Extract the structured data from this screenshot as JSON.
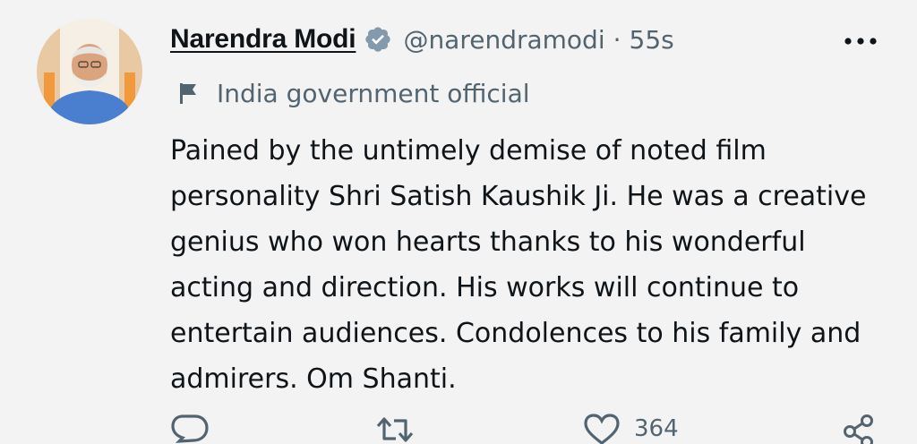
{
  "author": {
    "name": "Narendra Modi",
    "handle": "@narendramodi",
    "separator": "·",
    "time": "55s"
  },
  "label": {
    "text": "India government official",
    "icon": "flag-icon"
  },
  "tweet": {
    "text": "Pained by the untimely demise of noted film personality Shri Satish Kaushik Ji. He was a creative genius who won hearts thanks to his wonderful acting and direction. His works will continue to entertain audiences. Condolences to his family and admirers. Om Shanti."
  },
  "actions": {
    "reply_icon": "reply-icon",
    "retweet_icon": "retweet-icon",
    "like_icon": "heart-icon",
    "like_count": "364",
    "share_icon": "share-icon"
  },
  "colors": {
    "text_primary": "#0f1419",
    "text_secondary": "#536471",
    "verified_badge": "#829aab",
    "background": "#f3f3f3"
  }
}
